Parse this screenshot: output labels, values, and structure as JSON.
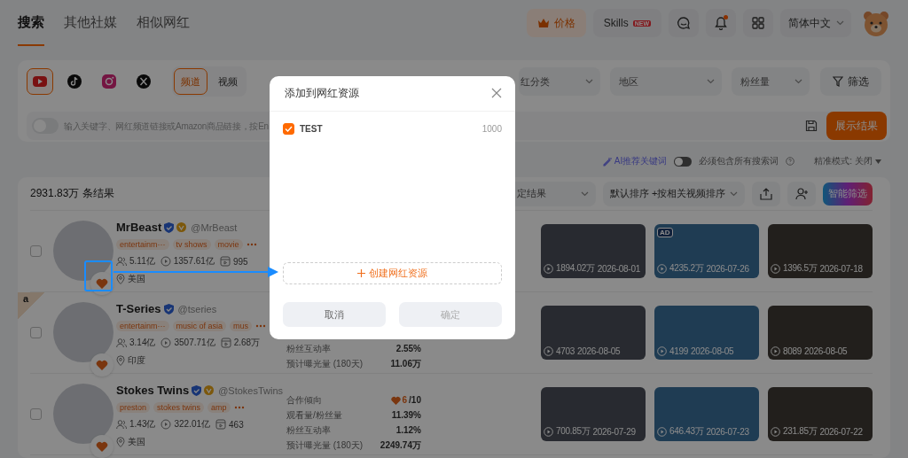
{
  "nav": {
    "tabs": [
      {
        "label": "搜索",
        "selected": true
      },
      {
        "label": "其他社媒",
        "selected": false
      },
      {
        "label": "相似网红",
        "selected": false
      }
    ],
    "price_button": "价格",
    "skills": {
      "label": "Skills",
      "badge": "NEW"
    },
    "has_notification": true,
    "language": "简体中文"
  },
  "filters": {
    "platforms": [
      {
        "kind": "youtube",
        "selected": true
      },
      {
        "kind": "tiktok",
        "selected": false
      },
      {
        "kind": "instagram",
        "selected": false
      },
      {
        "kind": "x",
        "selected": false
      }
    ],
    "content_types": [
      {
        "label": "频道",
        "selected": true
      },
      {
        "label": "视频",
        "selected": false
      }
    ],
    "dropdowns": [
      {
        "placeholder": "红分类"
      },
      {
        "placeholder": "地区"
      },
      {
        "placeholder": "粉丝量"
      }
    ],
    "filter_button": "筛选",
    "ai_toggle": {
      "on": false
    },
    "search": {
      "placeholder": "输入关键字、网红频道链接或Amazon商品链接，按En"
    },
    "submit": "展示结果"
  },
  "options": {
    "ai_keywords": "AI推荐关键词",
    "must_include": {
      "label": "必须包含所有搜索词",
      "on": false
    },
    "precise_mode": {
      "label": "精准模式:",
      "value": "关闭"
    }
  },
  "results": {
    "count": "2931.83万 条结果",
    "status_filter": "定结果",
    "sort": "默认排序 +按相关视频排序",
    "smart_filter": "智能筛选",
    "rows": [
      {
        "name": "MrBeast",
        "handle": "@MrBeast",
        "checked": false,
        "verified": true,
        "gold_badge": true,
        "corner_badge": null,
        "favorited": true,
        "tags": [
          "entertainm···",
          "tv shows",
          "movie"
        ],
        "followers": "5.11亿",
        "views": "1357.61亿",
        "videos": "995",
        "location": "美国",
        "metrics": [],
        "videos_list": [
          {
            "views": "1894.02万",
            "date": "2026-08-01"
          },
          {
            "views": "4235.2万",
            "date": "2026-07-26",
            "badge": "AD"
          },
          {
            "views": "1396.5万",
            "date": "2026-07-18"
          }
        ]
      },
      {
        "name": "T-Series",
        "handle": "@tseries",
        "checked": false,
        "verified": true,
        "gold_badge": false,
        "corner_badge": "a",
        "favorited": true,
        "tags": [
          "entertainm···",
          "music of asia",
          "mus"
        ],
        "followers": "3.14亿",
        "views": "3507.71亿",
        "videos": "2.68万",
        "location": "印度",
        "metrics": [
          {
            "kind": "plain",
            "label": "粉丝互动率",
            "value": "2.55%"
          },
          {
            "kind": "plain",
            "label": "预计曝光量 (180天)",
            "value": "11.06万"
          }
        ],
        "videos_list": [
          {
            "views": "4703",
            "date": "2026-08-05"
          },
          {
            "views": "4199",
            "date": "2026-08-05"
          },
          {
            "views": "8089",
            "date": "2026-08-05"
          }
        ]
      },
      {
        "name": "Stokes Twins",
        "handle": "@StokesTwins",
        "checked": false,
        "verified": true,
        "gold_badge": true,
        "corner_badge": null,
        "favorited": true,
        "tags": [
          "preston",
          "stokes twins",
          "amp"
        ],
        "followers": "1.43亿",
        "views": "322.01亿",
        "videos": "463",
        "location": "美国",
        "metrics": [
          {
            "kind": "score",
            "label": "合作倾向",
            "value": "6",
            "suffix": "/10"
          },
          {
            "kind": "plain",
            "label": "观看量/粉丝量",
            "value": "11.39%"
          },
          {
            "kind": "plain",
            "label": "粉丝互动率",
            "value": "1.12%"
          },
          {
            "kind": "plain",
            "label": "预计曝光量 (180天)",
            "value": "2249.74万"
          }
        ],
        "videos_list": [
          {
            "views": "700.85万",
            "date": "2026-07-29"
          },
          {
            "views": "646.43万",
            "date": "2026-07-23"
          },
          {
            "views": "231.85万",
            "date": "2026-07-22"
          }
        ]
      }
    ]
  },
  "modal": {
    "title": "添加到网红资源",
    "lists": [
      {
        "name": "TEST",
        "count": "1000",
        "checked": true
      }
    ],
    "create": "创建网红资源",
    "cancel": "取消",
    "confirm": "确定",
    "confirm_disabled": true
  }
}
